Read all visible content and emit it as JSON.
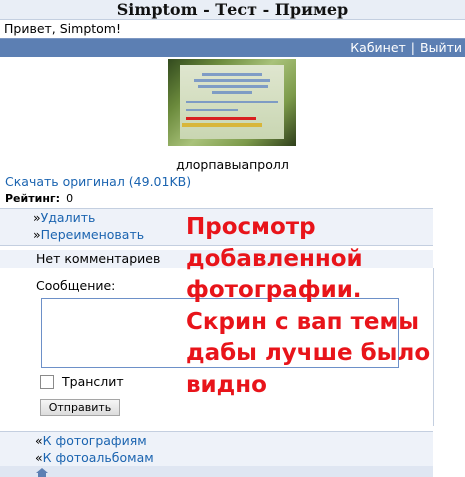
{
  "header": {
    "title": "Simptom - Тест - Пример"
  },
  "greeting": "Привет, Simptom!",
  "nav": {
    "cabinet": "Кабинет",
    "separator": "|",
    "logout": "Выйти"
  },
  "photo": {
    "caption": "длорпавыапролл"
  },
  "download": {
    "label": "Скачать оригинал (49.01KB)"
  },
  "rating": {
    "label": "Рейтинг:",
    "value": "0"
  },
  "actions": [
    {
      "arrow": "»",
      "label": "Удалить"
    },
    {
      "arrow": "»",
      "label": "Переименовать"
    }
  ],
  "comments": {
    "empty": "Нет комментариев"
  },
  "form": {
    "message_label": "Сообщение:",
    "message_value": "",
    "translit_label": "Транслит",
    "submit_label": "Отправить"
  },
  "links": [
    {
      "arrow": "«",
      "label": "К фотографиям"
    },
    {
      "arrow": "«",
      "label": "К фотоальбомам"
    }
  ],
  "overlay": {
    "lines": [
      "Просмотр",
      "добавленной",
      "фотографии.",
      "Скрин с вап темы",
      "дабы лучше было",
      "видно"
    ],
    "color": "#e8141a"
  }
}
